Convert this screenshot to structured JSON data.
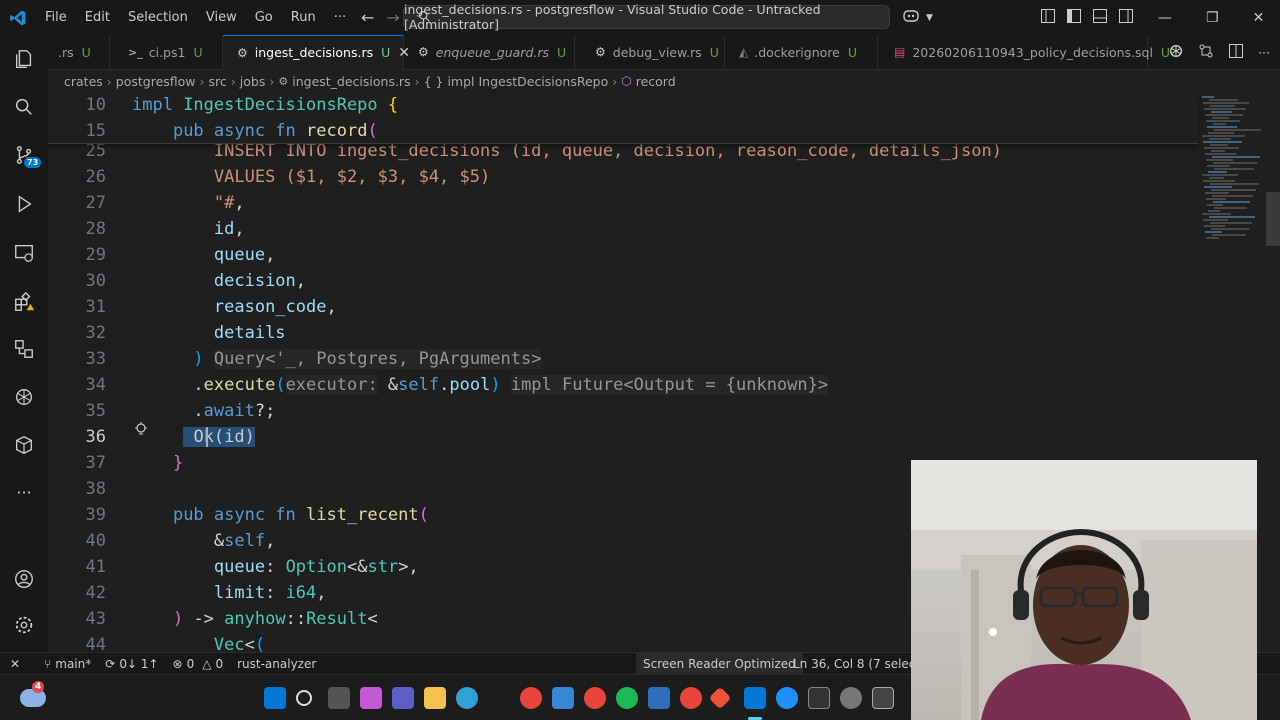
{
  "menu": [
    "File",
    "Edit",
    "Selection",
    "View",
    "Go",
    "Run"
  ],
  "menu_more": "···",
  "command_center": "ingest_decisions.rs - postgresflow - Visual Studio Code - Untracked [Administrator]",
  "activity_badges": {
    "source_control": "73"
  },
  "tabs": [
    {
      "label": ".rs",
      "status": "U",
      "icon": "rust-icon"
    },
    {
      "label": "ci.ps1",
      "status": "U",
      "icon": "powershell-icon"
    },
    {
      "label": "ingest_decisions.rs",
      "status": "U",
      "icon": "rust-icon",
      "active": true
    },
    {
      "label": "enqueue_guard.rs",
      "status": "U",
      "icon": "rust-icon",
      "italic": true
    },
    {
      "label": "debug_view.rs",
      "status": "U",
      "icon": "rust-icon"
    },
    {
      "label": ".dockerignore",
      "status": "U",
      "icon": "docker-icon"
    },
    {
      "label": "20260206110943_policy_decisions.sql",
      "status": "U",
      "icon": "database-icon"
    }
  ],
  "breadcrumb": [
    "crates",
    "postgresflow",
    "src",
    "jobs",
    "ingest_decisions.rs",
    "{ } impl IngestDecisionsRepo",
    "record"
  ],
  "sticky_lines": [
    {
      "num": "10",
      "tokens": [
        [
          "kw",
          "impl "
        ],
        [
          "ty",
          "IngestDecisionsRepo"
        ],
        [
          "pu",
          " "
        ],
        [
          "br",
          "{"
        ]
      ]
    },
    {
      "num": "15",
      "tokens": [
        [
          "pu",
          "    "
        ],
        [
          "kw",
          "pub async fn "
        ],
        [
          "fn",
          "record"
        ],
        [
          "br2",
          "("
        ]
      ]
    }
  ],
  "code_lines": [
    {
      "num": "25",
      "tokens": [
        [
          "pu",
          "        "
        ],
        [
          "str",
          "INSERT INTO ingest_decisions (id, queue, decision, reason_code, details_json)"
        ]
      ]
    },
    {
      "num": "26",
      "tokens": [
        [
          "pu",
          "        "
        ],
        [
          "str",
          "VALUES ($1, $2, $3, $4, $5)"
        ]
      ]
    },
    {
      "num": "27",
      "tokens": [
        [
          "pu",
          "        "
        ],
        [
          "str",
          "\"#"
        ],
        [
          "pu",
          ","
        ]
      ]
    },
    {
      "num": "28",
      "tokens": [
        [
          "pu",
          "        "
        ],
        [
          "var",
          "id"
        ],
        [
          "pu",
          ","
        ]
      ]
    },
    {
      "num": "29",
      "tokens": [
        [
          "pu",
          "        "
        ],
        [
          "var",
          "queue"
        ],
        [
          "pu",
          ","
        ]
      ]
    },
    {
      "num": "30",
      "tokens": [
        [
          "pu",
          "        "
        ],
        [
          "var",
          "decision"
        ],
        [
          "pu",
          ","
        ]
      ]
    },
    {
      "num": "31",
      "tokens": [
        [
          "pu",
          "        "
        ],
        [
          "var",
          "reason_code"
        ],
        [
          "pu",
          ","
        ]
      ]
    },
    {
      "num": "32",
      "tokens": [
        [
          "pu",
          "        "
        ],
        [
          "var",
          "details"
        ]
      ]
    },
    {
      "num": "33",
      "tokens": [
        [
          "pu",
          "      "
        ],
        [
          "br3",
          ")"
        ],
        [
          "pu",
          " "
        ],
        [
          "hint",
          "Query<'_, Postgres, PgArguments>"
        ]
      ]
    },
    {
      "num": "34",
      "tokens": [
        [
          "pu",
          "      ."
        ],
        [
          "fn",
          "execute"
        ],
        [
          "br3",
          "("
        ],
        [
          "hint",
          "executor:"
        ],
        [
          "pu",
          " &"
        ],
        [
          "kw",
          "self"
        ],
        [
          "pu",
          "."
        ],
        [
          "var",
          "pool"
        ],
        [
          "br3",
          ")"
        ],
        [
          "pu",
          " "
        ],
        [
          "hint",
          "impl Future<Output = {unknown}>"
        ]
      ]
    },
    {
      "num": "35",
      "tokens": [
        [
          "pu",
          "      ."
        ],
        [
          "kw",
          "await"
        ],
        [
          "pu",
          "?;"
        ]
      ]
    },
    {
      "num": "36",
      "tokens": [
        [
          "pu",
          "     "
        ],
        [
          "sel",
          " "
        ],
        [
          "sel",
          "Ok"
        ],
        [
          "sel",
          "("
        ],
        [
          "sel",
          "id"
        ],
        [
          "sel",
          ")"
        ]
      ],
      "current": true
    },
    {
      "num": "37",
      "tokens": [
        [
          "pu",
          "    "
        ],
        [
          "br2",
          "}"
        ]
      ]
    },
    {
      "num": "38",
      "tokens": []
    },
    {
      "num": "39",
      "tokens": [
        [
          "pu",
          "    "
        ],
        [
          "kw",
          "pub async fn "
        ],
        [
          "fn",
          "list_recent"
        ],
        [
          "br2",
          "("
        ]
      ]
    },
    {
      "num": "40",
      "tokens": [
        [
          "pu",
          "        &"
        ],
        [
          "kw",
          "self"
        ],
        [
          "pu",
          ","
        ]
      ]
    },
    {
      "num": "41",
      "tokens": [
        [
          "pu",
          "        "
        ],
        [
          "var",
          "queue"
        ],
        [
          "pu",
          ": "
        ],
        [
          "ty",
          "Option"
        ],
        [
          "pu",
          "<&"
        ],
        [
          "ty",
          "str"
        ],
        [
          "pu",
          ">,"
        ]
      ]
    },
    {
      "num": "42",
      "tokens": [
        [
          "pu",
          "        "
        ],
        [
          "var",
          "limit"
        ],
        [
          "pu",
          ": "
        ],
        [
          "ty",
          "i64"
        ],
        [
          "pu",
          ","
        ]
      ]
    },
    {
      "num": "43",
      "tokens": [
        [
          "pu",
          "    "
        ],
        [
          "br2",
          ")"
        ],
        [
          "pu",
          " -> "
        ],
        [
          "ty",
          "anyhow"
        ],
        [
          "pu",
          "::"
        ],
        [
          "ty",
          "Result"
        ],
        [
          "pu",
          "<"
        ]
      ]
    },
    {
      "num": "44",
      "tokens": [
        [
          "pu",
          "        "
        ],
        [
          "ty",
          "Vec"
        ],
        [
          "pu",
          "<"
        ],
        [
          "br3",
          "("
        ]
      ]
    }
  ],
  "status": {
    "branch": "main*",
    "sync": "0↓ 1↑",
    "errors": "0",
    "warnings": "0",
    "analyzer": "rust-analyzer",
    "screen_reader": "Screen Reader Optimized",
    "cursor": "Ln 36, Col 8 (7 selected)"
  },
  "taskbar": {
    "weather_badge": "4"
  },
  "colors": {
    "accent": "#0078d4",
    "bg": "#1f1f1f",
    "chrome": "#181818"
  }
}
